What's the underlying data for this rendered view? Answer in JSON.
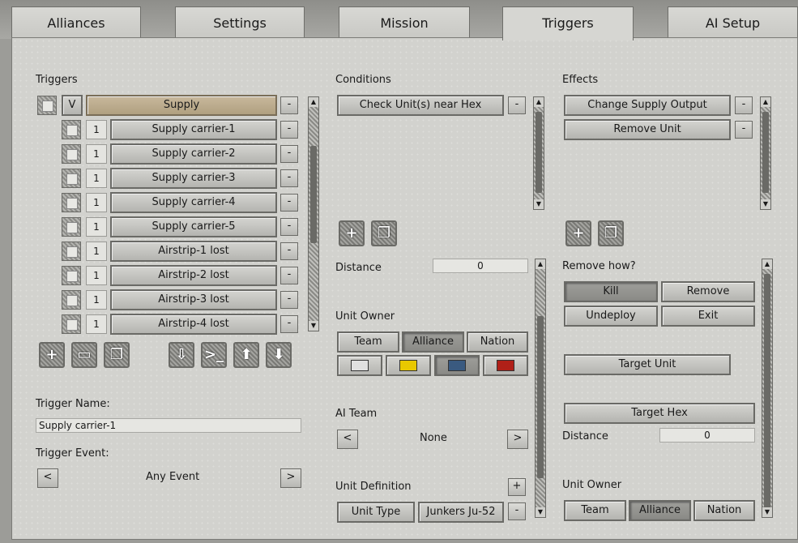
{
  "tabs": [
    "Alliances",
    "Settings",
    "Mission",
    "Triggers",
    "AI Setup"
  ],
  "triggers": {
    "title": "Triggers",
    "group": {
      "toggle": "V",
      "label": "Supply",
      "remove": "-"
    },
    "items": [
      {
        "num": "1",
        "label": "Supply carrier-1"
      },
      {
        "num": "1",
        "label": "Supply carrier-2"
      },
      {
        "num": "1",
        "label": "Supply carrier-3"
      },
      {
        "num": "1",
        "label": "Supply carrier-4"
      },
      {
        "num": "1",
        "label": "Supply carrier-5"
      },
      {
        "num": "1",
        "label": "Airstrip-1 lost"
      },
      {
        "num": "1",
        "label": "Airstrip-2 lost"
      },
      {
        "num": "1",
        "label": "Airstrip-3 lost"
      },
      {
        "num": "1",
        "label": "Airstrip-4 lost"
      }
    ],
    "remove": "-",
    "toolbar_icons": [
      "add-icon",
      "folder-icon",
      "copy-icon",
      "import-icon",
      "console-icon",
      "move-up-icon",
      "move-down-icon"
    ],
    "name_label": "Trigger Name:",
    "name_value": "Supply carrier-1",
    "event_label": "Trigger Event:",
    "event_value": "Any Event",
    "prev": "<",
    "next": ">"
  },
  "conditions": {
    "title": "Conditions",
    "items": [
      "Check Unit(s) near Hex"
    ],
    "remove": "-",
    "distance_label": "Distance",
    "distance_value": "0",
    "owner_label": "Unit Owner",
    "owner_options": [
      "Team",
      "Alliance",
      "Nation"
    ],
    "team_colors": [
      "#e0e0e0",
      "#e8c800",
      "#3a5a80",
      "#b02018"
    ],
    "ai_team_label": "AI Team",
    "ai_team_value": "None",
    "prev": "<",
    "next": ">",
    "unit_def_label": "Unit Definition",
    "plus": "+",
    "minus": "-",
    "unit_type_label": "Unit Type",
    "unit_type_value": "Junkers Ju-52"
  },
  "effects": {
    "title": "Effects",
    "items": [
      "Change Supply Output",
      "Remove Unit"
    ],
    "remove": "-",
    "remove_how_label": "Remove how?",
    "remove_options": [
      "Kill",
      "Remove",
      "Undeploy",
      "Exit"
    ],
    "target_unit": "Target Unit",
    "target_hex": "Target Hex",
    "distance_label": "Distance",
    "distance_value": "0",
    "owner_label": "Unit Owner",
    "owner_options": [
      "Team",
      "Alliance",
      "Nation"
    ]
  },
  "icons": {
    "add": "add-icon",
    "copy": "copy-icon"
  }
}
